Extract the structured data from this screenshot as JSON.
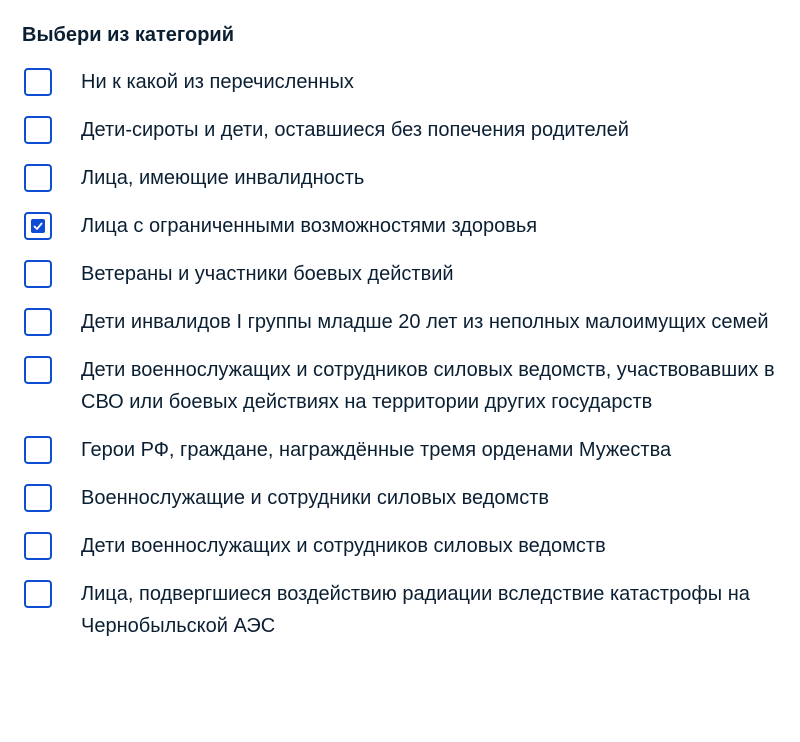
{
  "title": "Выбери из категорий",
  "accent_color": "#0d4cd3",
  "options": [
    {
      "label": "Ни к какой из перечисленных",
      "checked": false
    },
    {
      "label": "Дети-сироты и дети, оставшиеся без попечения родителей",
      "checked": false
    },
    {
      "label": "Лица, имеющие инвалидность",
      "checked": false
    },
    {
      "label": "Лица с ограниченными возможностями здоровья",
      "checked": true
    },
    {
      "label": "Ветераны и участники боевых действий",
      "checked": false
    },
    {
      "label": "Дети инвалидов I группы младше 20 лет из неполных малоимущих семей",
      "checked": false
    },
    {
      "label": "Дети военнослужащих и сотрудников силовых ведомств, участвовавших в СВО или боевых действиях на территории других государств",
      "checked": false
    },
    {
      "label": "Герои РФ, граждане, награждённые тремя орденами Мужества",
      "checked": false
    },
    {
      "label": "Военнослужащие и сотрудники силовых ведомств",
      "checked": false
    },
    {
      "label": "Дети военнослужащих и сотрудников силовых ведомств",
      "checked": false
    },
    {
      "label": "Лица, подвергшиеся воздействию радиации вследствие катастрофы на Чернобыльской АЭС",
      "checked": false
    }
  ]
}
